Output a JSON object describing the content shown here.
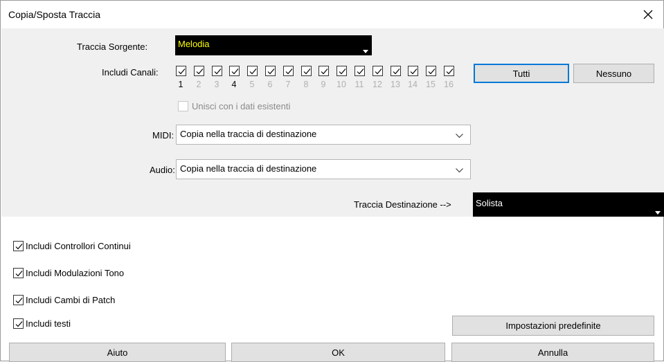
{
  "window": {
    "title": "Copia/Sposta Traccia"
  },
  "source": {
    "label": "Traccia Sorgente:",
    "value": "Melodia"
  },
  "channels": {
    "label": "Includi Canali:",
    "items": [
      {
        "n": "1",
        "checked": true,
        "active": true
      },
      {
        "n": "2",
        "checked": true,
        "active": false
      },
      {
        "n": "3",
        "checked": true,
        "active": false
      },
      {
        "n": "4",
        "checked": true,
        "active": true
      },
      {
        "n": "5",
        "checked": true,
        "active": false
      },
      {
        "n": "6",
        "checked": true,
        "active": false
      },
      {
        "n": "7",
        "checked": true,
        "active": false
      },
      {
        "n": "8",
        "checked": true,
        "active": false
      },
      {
        "n": "9",
        "checked": true,
        "active": false
      },
      {
        "n": "10",
        "checked": true,
        "active": false
      },
      {
        "n": "11",
        "checked": true,
        "active": false
      },
      {
        "n": "12",
        "checked": true,
        "active": false
      },
      {
        "n": "13",
        "checked": true,
        "active": false
      },
      {
        "n": "14",
        "checked": true,
        "active": false
      },
      {
        "n": "15",
        "checked": true,
        "active": false
      },
      {
        "n": "16",
        "checked": true,
        "active": false
      }
    ],
    "all_label": "Tutti",
    "none_label": "Nessuno"
  },
  "merge": {
    "label": "Unisci con i dati esistenti",
    "checked": false,
    "enabled": false
  },
  "midi": {
    "label": "MIDI:",
    "value": "Copia nella traccia di destinazione"
  },
  "audio": {
    "label": "Audio:",
    "value": "Copia nella traccia di destinazione"
  },
  "destination": {
    "label": "Traccia Destinazione -->",
    "value": "Solista"
  },
  "options": [
    {
      "label": "Includi Controllori Continui",
      "checked": true
    },
    {
      "label": "Includi Modulazioni Tono",
      "checked": true
    },
    {
      "label": "Includi Cambi di Patch",
      "checked": true
    },
    {
      "label": "Includi testi",
      "checked": true
    }
  ],
  "buttons": {
    "defaults": "Impostazioni predefinite",
    "help": "Aiuto",
    "ok": "OK",
    "cancel": "Annulla"
  },
  "colors": {
    "accent": "#0078d7",
    "source_text": "#ffff00"
  }
}
